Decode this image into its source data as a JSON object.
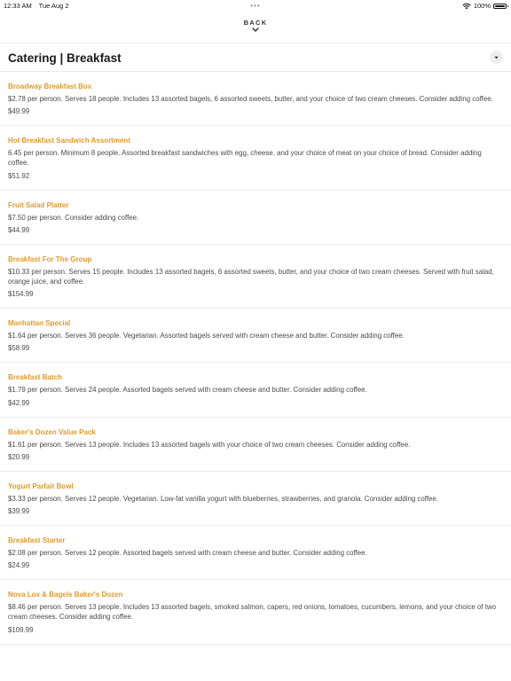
{
  "status_bar": {
    "time": "12:33 AM",
    "date": "Tue Aug 2",
    "battery": "100%",
    "multitask": "•••"
  },
  "nav": {
    "back_label": "BACK"
  },
  "header": {
    "title": "Catering | Breakfast"
  },
  "colors": {
    "accent": "#e39a2a",
    "text": "#4a4a4a",
    "title": "#1b1b1b"
  },
  "menu": {
    "items": [
      {
        "name": "Broadway Breakfast Box",
        "description": "$2.78 per person. Serves 18 people. Includes 13 assorted bagels, 6 assorted sweets, butter, and your choice of two cream cheeses. Consider adding coffee.",
        "price": "$49.99"
      },
      {
        "name": "Hot Breakfast Sandwich Assortment",
        "description": "6.45 per person. Minimum 8 people. Assorted breakfast sandwiches with egg, cheese, and your choice of meat on your choice of bread. Consider adding coffee.",
        "price": "$51.92"
      },
      {
        "name": "Fruit Salad Platter",
        "description": "$7.50 per person. Consider adding coffee.",
        "price": "$44.99"
      },
      {
        "name": "Breakfast For The Group",
        "description": "$10.33 per person. Serves 15 people. Includes 13 assorted bagels, 6 assorted sweets, butter, and your choice of two cream cheeses. Served with fruit salad, orange juice, and coffee.",
        "price": "$154.99"
      },
      {
        "name": "Manhattan Special",
        "description": "$1.64 per person. Serves 36 people. Vegetarian. Assorted bagels served with cream cheese and butter. Consider adding coffee.",
        "price": "$58.99"
      },
      {
        "name": "Breakfast Batch",
        "description": "$1.79 per person. Serves 24 people. Assorted bagels served with cream cheese and butter. Consider adding coffee.",
        "price": "$42.99"
      },
      {
        "name": "Baker's Dozen Value Pack",
        "description": "$1.61 per person. Serves 13 people. Includes 13 assorted bagels with your choice of two cream cheeses. Consider adding coffee.",
        "price": "$20.99"
      },
      {
        "name": "Yogurt Parfait Bowl",
        "description": "$3.33 per person. Serves 12 people. Vegetarian. Low-fat vanilla yogurt with blueberries, strawberries, and granola. Consider adding coffee.",
        "price": "$39.99"
      },
      {
        "name": "Breakfast Starter",
        "description": "$2.08 per person. Serves 12 people. Assorted bagels served with cream cheese and butter. Consider adding coffee.",
        "price": "$24.99"
      },
      {
        "name": "Nova Lox & Bagels Baker's Dozen",
        "description": "$8.46 per person. Serves 13 people. Includes 13 assorted bagels, smoked salmon, capers, red onions, tomatoes, cucumbers, lemons, and your choice of two cream cheeses. Consider adding coffee.",
        "price": "$109.99"
      }
    ]
  }
}
